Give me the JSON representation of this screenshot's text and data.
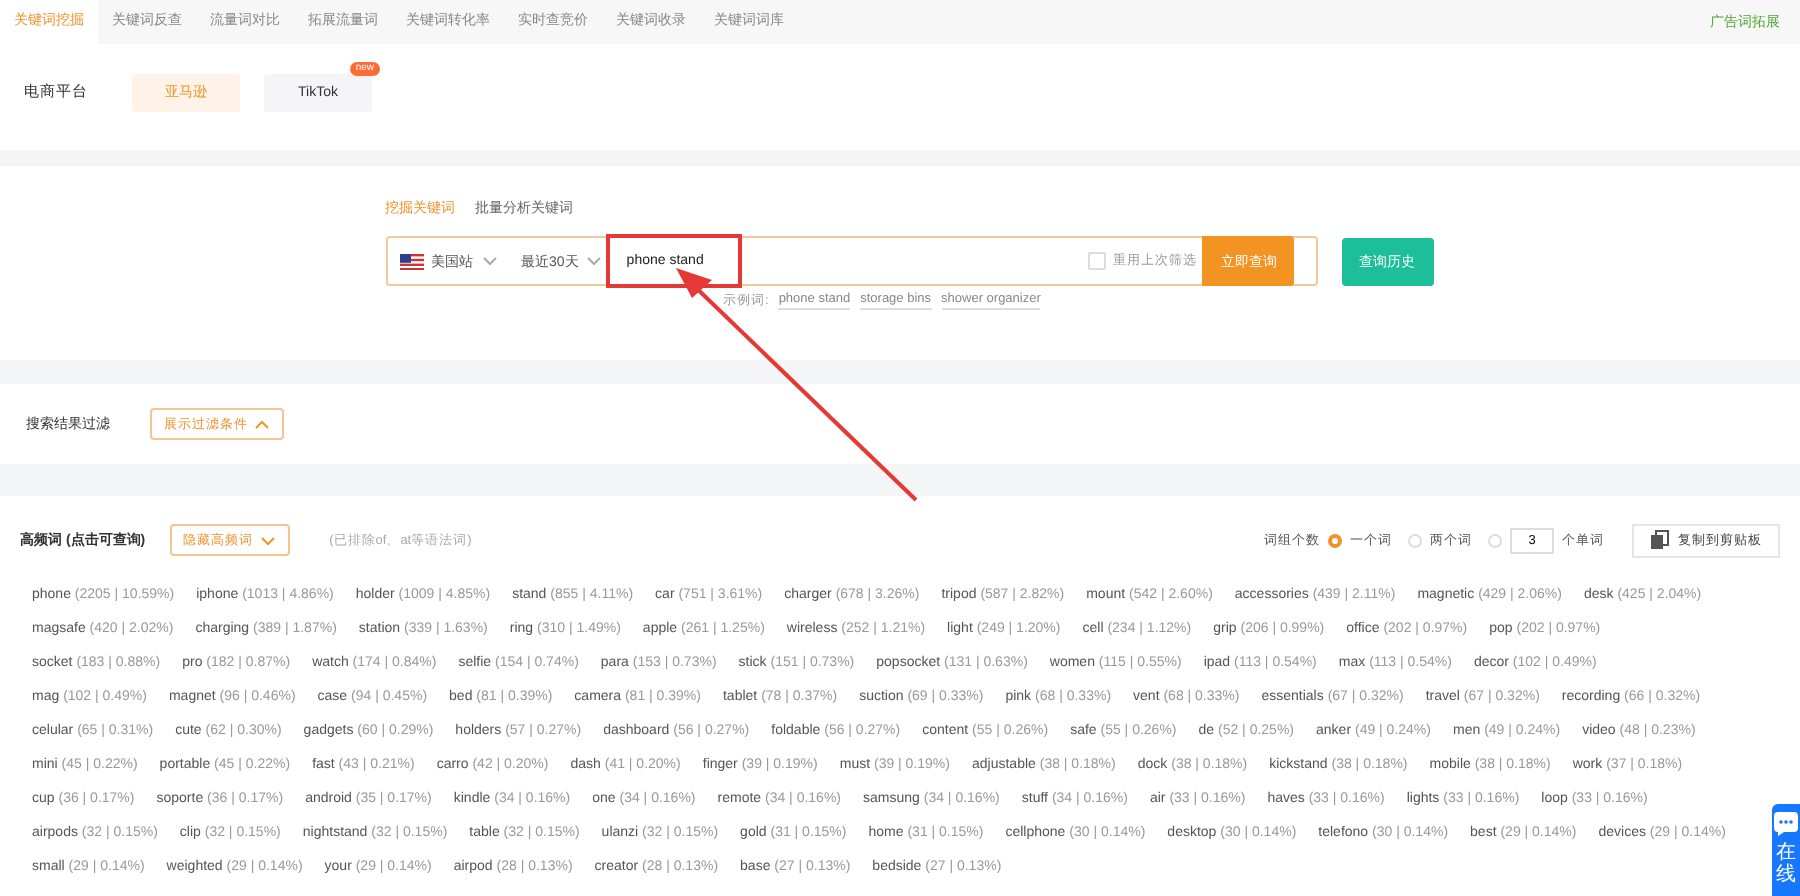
{
  "nav": {
    "tabs": [
      {
        "label": "关键词挖掘",
        "selected": true
      },
      {
        "label": "关键词反查",
        "selected": false
      },
      {
        "label": "流量词对比",
        "selected": false
      },
      {
        "label": "拓展流量词",
        "selected": false
      },
      {
        "label": "关键词转化率",
        "selected": false
      },
      {
        "label": "实时查竞价",
        "selected": false
      },
      {
        "label": "关键词收录",
        "selected": false
      },
      {
        "label": "关键词词库",
        "selected": false
      }
    ],
    "right_link": "广告词拓展"
  },
  "platform": {
    "label": "电商平台",
    "options": [
      {
        "label": "亚马逊",
        "selected": true
      },
      {
        "label": "TikTok",
        "selected": false,
        "badge": "new"
      }
    ]
  },
  "search": {
    "tabs": [
      {
        "label": "挖掘关键词",
        "selected": true
      },
      {
        "label": "批量分析关键词",
        "selected": false
      }
    ],
    "site": "美国站",
    "period": "最近30天",
    "value": "phone stand",
    "reuse": {
      "label": "重用上次筛选",
      "checked": false
    },
    "submit": "立即查询",
    "history": "查询历史",
    "examples_label": "示例词:",
    "examples": [
      "phone stand",
      "storage bins",
      "shower organizer"
    ]
  },
  "filter": {
    "label": "搜索结果过滤",
    "button": "展示过滤条件"
  },
  "high_freq": {
    "title": "高频词 (点击可查询)",
    "toggle": "隐藏高频词",
    "note": "(已排除of、at等语法词)",
    "group_label": "词组个数",
    "options": [
      {
        "kind": "radio",
        "label": "一个词",
        "selected": true
      },
      {
        "kind": "radio",
        "label": "两个词",
        "selected": false
      },
      {
        "kind": "input",
        "value": "3",
        "label": "个单词",
        "selected": false
      }
    ],
    "copy": "复制到剪贴板",
    "words": [
      {
        "word": "phone",
        "stat": "(2205 | 10.59%)"
      },
      {
        "word": "iphone",
        "stat": "(1013 | 4.86%)"
      },
      {
        "word": "holder",
        "stat": "(1009 | 4.85%)"
      },
      {
        "word": "stand",
        "stat": "(855 | 4.11%)"
      },
      {
        "word": "car",
        "stat": "(751 | 3.61%)"
      },
      {
        "word": "charger",
        "stat": "(678 | 3.26%)"
      },
      {
        "word": "tripod",
        "stat": "(587 | 2.82%)"
      },
      {
        "word": "mount",
        "stat": "(542 | 2.60%)"
      },
      {
        "word": "accessories",
        "stat": "(439 | 2.11%)"
      },
      {
        "word": "magnetic",
        "stat": "(429 | 2.06%)"
      },
      {
        "word": "desk",
        "stat": "(425 | 2.04%)"
      },
      {
        "word": "magsafe",
        "stat": "(420 | 2.02%)"
      },
      {
        "word": "charging",
        "stat": "(389 | 1.87%)"
      },
      {
        "word": "station",
        "stat": "(339 | 1.63%)"
      },
      {
        "word": "ring",
        "stat": "(310 | 1.49%)"
      },
      {
        "word": "apple",
        "stat": "(261 | 1.25%)"
      },
      {
        "word": "wireless",
        "stat": "(252 | 1.21%)"
      },
      {
        "word": "light",
        "stat": "(249 | 1.20%)"
      },
      {
        "word": "cell",
        "stat": "(234 | 1.12%)"
      },
      {
        "word": "grip",
        "stat": "(206 | 0.99%)"
      },
      {
        "word": "office",
        "stat": "(202 | 0.97%)"
      },
      {
        "word": "pop",
        "stat": "(202 | 0.97%)"
      },
      {
        "word": "socket",
        "stat": "(183 | 0.88%)"
      },
      {
        "word": "pro",
        "stat": "(182 | 0.87%)"
      },
      {
        "word": "watch",
        "stat": "(174 | 0.84%)"
      },
      {
        "word": "selfie",
        "stat": "(154 | 0.74%)"
      },
      {
        "word": "para",
        "stat": "(153 | 0.73%)"
      },
      {
        "word": "stick",
        "stat": "(151 | 0.73%)"
      },
      {
        "word": "popsocket",
        "stat": "(131 | 0.63%)"
      },
      {
        "word": "women",
        "stat": "(115 | 0.55%)"
      },
      {
        "word": "ipad",
        "stat": "(113 | 0.54%)"
      },
      {
        "word": "max",
        "stat": "(113 | 0.54%)"
      },
      {
        "word": "decor",
        "stat": "(102 | 0.49%)"
      },
      {
        "word": "mag",
        "stat": "(102 | 0.49%)"
      },
      {
        "word": "magnet",
        "stat": "(96 | 0.46%)"
      },
      {
        "word": "case",
        "stat": "(94 | 0.45%)"
      },
      {
        "word": "bed",
        "stat": "(81 | 0.39%)"
      },
      {
        "word": "camera",
        "stat": "(81 | 0.39%)"
      },
      {
        "word": "tablet",
        "stat": "(78 | 0.37%)"
      },
      {
        "word": "suction",
        "stat": "(69 | 0.33%)"
      },
      {
        "word": "pink",
        "stat": "(68 | 0.33%)"
      },
      {
        "word": "vent",
        "stat": "(68 | 0.33%)"
      },
      {
        "word": "essentials",
        "stat": "(67 | 0.32%)"
      },
      {
        "word": "travel",
        "stat": "(67 | 0.32%)"
      },
      {
        "word": "recording",
        "stat": "(66 | 0.32%)"
      },
      {
        "word": "celular",
        "stat": "(65 | 0.31%)"
      },
      {
        "word": "cute",
        "stat": "(62 | 0.30%)"
      },
      {
        "word": "gadgets",
        "stat": "(60 | 0.29%)"
      },
      {
        "word": "holders",
        "stat": "(57 | 0.27%)"
      },
      {
        "word": "dashboard",
        "stat": "(56 | 0.27%)"
      },
      {
        "word": "foldable",
        "stat": "(56 | 0.27%)"
      },
      {
        "word": "content",
        "stat": "(55 | 0.26%)"
      },
      {
        "word": "safe",
        "stat": "(55 | 0.26%)"
      },
      {
        "word": "de",
        "stat": "(52 | 0.25%)"
      },
      {
        "word": "anker",
        "stat": "(49 | 0.24%)"
      },
      {
        "word": "men",
        "stat": "(49 | 0.24%)"
      },
      {
        "word": "video",
        "stat": "(48 | 0.23%)"
      },
      {
        "word": "mini",
        "stat": "(45 | 0.22%)"
      },
      {
        "word": "portable",
        "stat": "(45 | 0.22%)"
      },
      {
        "word": "fast",
        "stat": "(43 | 0.21%)"
      },
      {
        "word": "carro",
        "stat": "(42 | 0.20%)"
      },
      {
        "word": "dash",
        "stat": "(41 | 0.20%)"
      },
      {
        "word": "finger",
        "stat": "(39 | 0.19%)"
      },
      {
        "word": "must",
        "stat": "(39 | 0.19%)"
      },
      {
        "word": "adjustable",
        "stat": "(38 | 0.18%)"
      },
      {
        "word": "dock",
        "stat": "(38 | 0.18%)"
      },
      {
        "word": "kickstand",
        "stat": "(38 | 0.18%)"
      },
      {
        "word": "mobile",
        "stat": "(38 | 0.18%)"
      },
      {
        "word": "work",
        "stat": "(37 | 0.18%)"
      },
      {
        "word": "cup",
        "stat": "(36 | 0.17%)"
      },
      {
        "word": "soporte",
        "stat": "(36 | 0.17%)"
      },
      {
        "word": "android",
        "stat": "(35 | 0.17%)"
      },
      {
        "word": "kindle",
        "stat": "(34 | 0.16%)"
      },
      {
        "word": "one",
        "stat": "(34 | 0.16%)"
      },
      {
        "word": "remote",
        "stat": "(34 | 0.16%)"
      },
      {
        "word": "samsung",
        "stat": "(34 | 0.16%)"
      },
      {
        "word": "stuff",
        "stat": "(34 | 0.16%)"
      },
      {
        "word": "air",
        "stat": "(33 | 0.16%)"
      },
      {
        "word": "haves",
        "stat": "(33 | 0.16%)"
      },
      {
        "word": "lights",
        "stat": "(33 | 0.16%)"
      },
      {
        "word": "loop",
        "stat": "(33 | 0.16%)"
      },
      {
        "word": "airpods",
        "stat": "(32 | 0.15%)"
      },
      {
        "word": "clip",
        "stat": "(32 | 0.15%)"
      },
      {
        "word": "nightstand",
        "stat": "(32 | 0.15%)"
      },
      {
        "word": "table",
        "stat": "(32 | 0.15%)"
      },
      {
        "word": "ulanzi",
        "stat": "(32 | 0.15%)"
      },
      {
        "word": "gold",
        "stat": "(31 | 0.15%)"
      },
      {
        "word": "home",
        "stat": "(31 | 0.15%)"
      },
      {
        "word": "cellphone",
        "stat": "(30 | 0.14%)"
      },
      {
        "word": "desktop",
        "stat": "(30 | 0.14%)"
      },
      {
        "word": "telefono",
        "stat": "(30 | 0.14%)"
      },
      {
        "word": "best",
        "stat": "(29 | 0.14%)"
      },
      {
        "word": "devices",
        "stat": "(29 | 0.14%)"
      },
      {
        "word": "small",
        "stat": "(29 | 0.14%)"
      },
      {
        "word": "weighted",
        "stat": "(29 | 0.14%)"
      },
      {
        "word": "your",
        "stat": "(29 | 0.14%)"
      },
      {
        "word": "airpod",
        "stat": "(28 | 0.13%)"
      },
      {
        "word": "creator",
        "stat": "(28 | 0.13%)"
      },
      {
        "word": "base",
        "stat": "(27 | 0.13%)"
      },
      {
        "word": "bedside",
        "stat": "(27 | 0.13%)"
      }
    ]
  },
  "chat_tab": {
    "label": "在线"
  }
}
